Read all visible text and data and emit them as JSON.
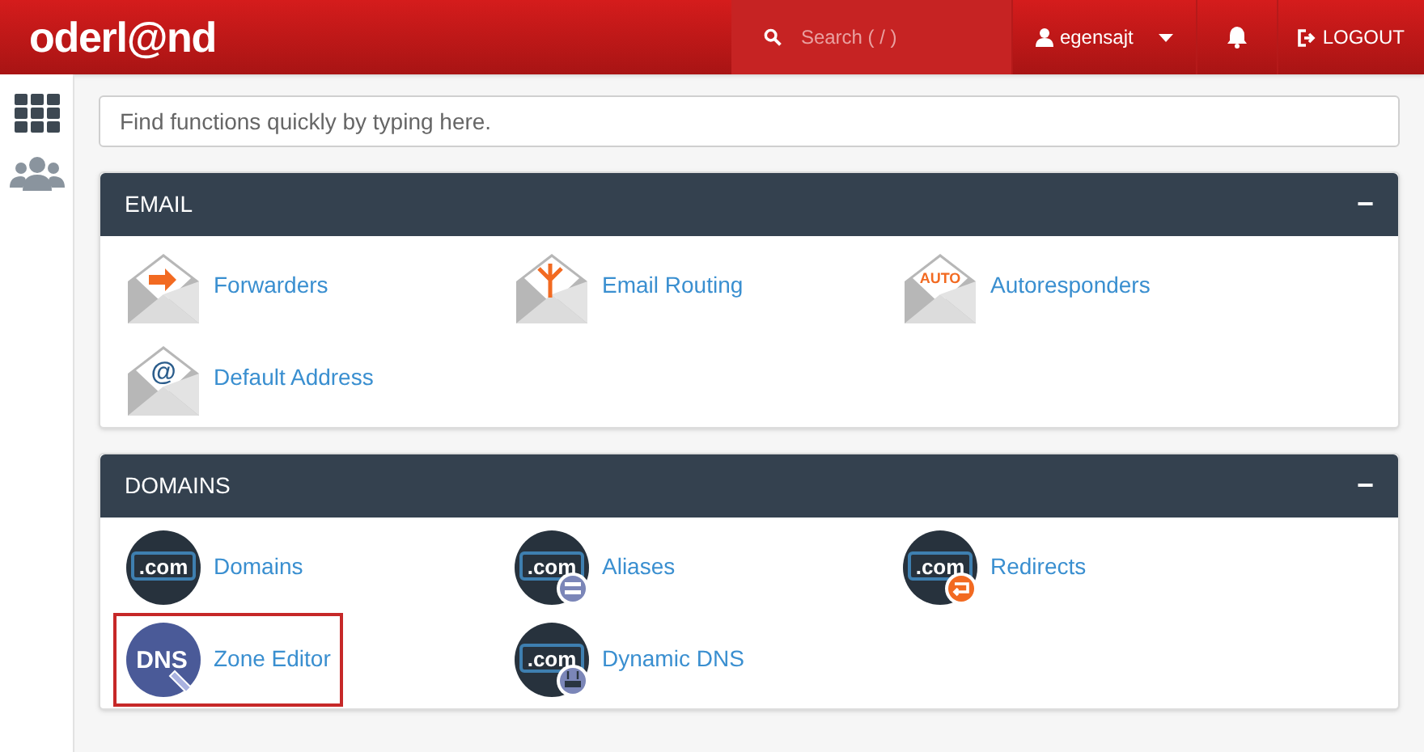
{
  "header": {
    "logo": "oderl@nd",
    "search": {
      "placeholder": "Search ( / )"
    },
    "user": "egensajt",
    "logout": "LOGOUT"
  },
  "search": {
    "placeholder": "Find functions quickly by typing here."
  },
  "panels": [
    {
      "title": "EMAIL",
      "toggle": "−",
      "items": [
        {
          "label": "Forwarders",
          "kind": "forward",
          "highlighted": false
        },
        {
          "label": "Email Routing",
          "kind": "routing",
          "highlighted": false
        },
        {
          "label": "Autoresponders",
          "kind": "autoreply",
          "icon_text": "AUTO",
          "highlighted": false
        },
        {
          "label": "Default Address",
          "kind": "address",
          "icon_text": "@",
          "highlighted": false
        }
      ]
    },
    {
      "title": "DOMAINS",
      "toggle": "−",
      "items": [
        {
          "label": "Domains",
          "kind": "domain",
          "icon_text": ".com",
          "highlighted": false
        },
        {
          "label": "Aliases",
          "kind": "alias",
          "icon_text": ".com",
          "highlighted": false
        },
        {
          "label": "Redirects",
          "kind": "redirect",
          "icon_text": ".com",
          "highlighted": false
        },
        {
          "label": "Zone Editor",
          "kind": "dns",
          "icon_text": "DNS",
          "highlighted": true
        },
        {
          "label": "Dynamic DNS",
          "kind": "dyndns",
          "icon_text": ".com",
          "highlighted": false
        }
      ]
    }
  ]
}
